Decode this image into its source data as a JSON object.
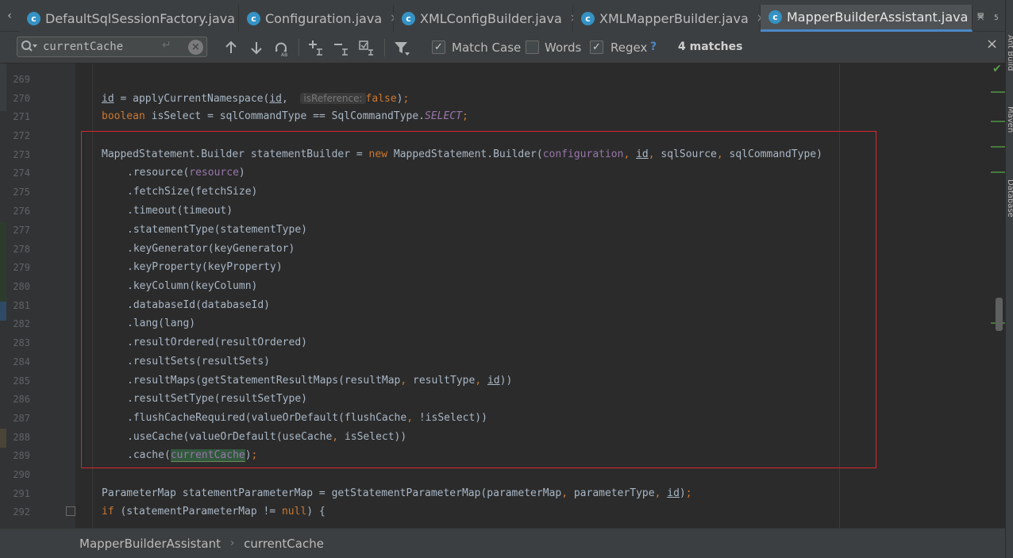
{
  "tabs": [
    {
      "label": "DefaultSqlSessionFactory.java",
      "icon": "class-icon",
      "active": false
    },
    {
      "label": "Configuration.java",
      "icon": "class-icon",
      "active": false
    },
    {
      "label": "XMLConfigBuilder.java",
      "icon": "class-icon",
      "active": false
    },
    {
      "label": "XMLMapperBuilder.java",
      "icon": "class-icon",
      "active": false
    },
    {
      "label": "MapperBuilderAssistant.java",
      "icon": "class-icon",
      "active": true
    }
  ],
  "tab_icon_glyph": "c",
  "tab_close_glyph": "×",
  "tab_overflow": {
    "glyph": "≡",
    "count": "5"
  },
  "find": {
    "query": "currentCache",
    "enter_glyph": "↵",
    "clear_glyph": "×",
    "match_case": {
      "label": "Match Case",
      "checked": true
    },
    "words": {
      "label": "Words",
      "checked": false
    },
    "regex": {
      "label": "Regex",
      "checked": true
    },
    "help": "?",
    "matches": "4 matches",
    "close_glyph": "×"
  },
  "line_numbers": [
    "269",
    "270",
    "271",
    "272",
    "273",
    "274",
    "275",
    "276",
    "277",
    "278",
    "279",
    "280",
    "281",
    "282",
    "283",
    "284",
    "285",
    "286",
    "287",
    "288",
    "289",
    "290",
    "291",
    "292"
  ],
  "inlay_hint": "isReference:",
  "breadcrumb": {
    "class_name": "MapperBuilderAssistant",
    "member": "currentCache",
    "separator": "›"
  },
  "side_tools": [
    "Ant Build",
    "Maven",
    "Database"
  ],
  "colors": {
    "keyword": "#cc7832",
    "field": "#9876aa",
    "match_bg": "#32593d",
    "active_tab_underline": "#4a88c7",
    "highlight_box": "#d9272d"
  }
}
